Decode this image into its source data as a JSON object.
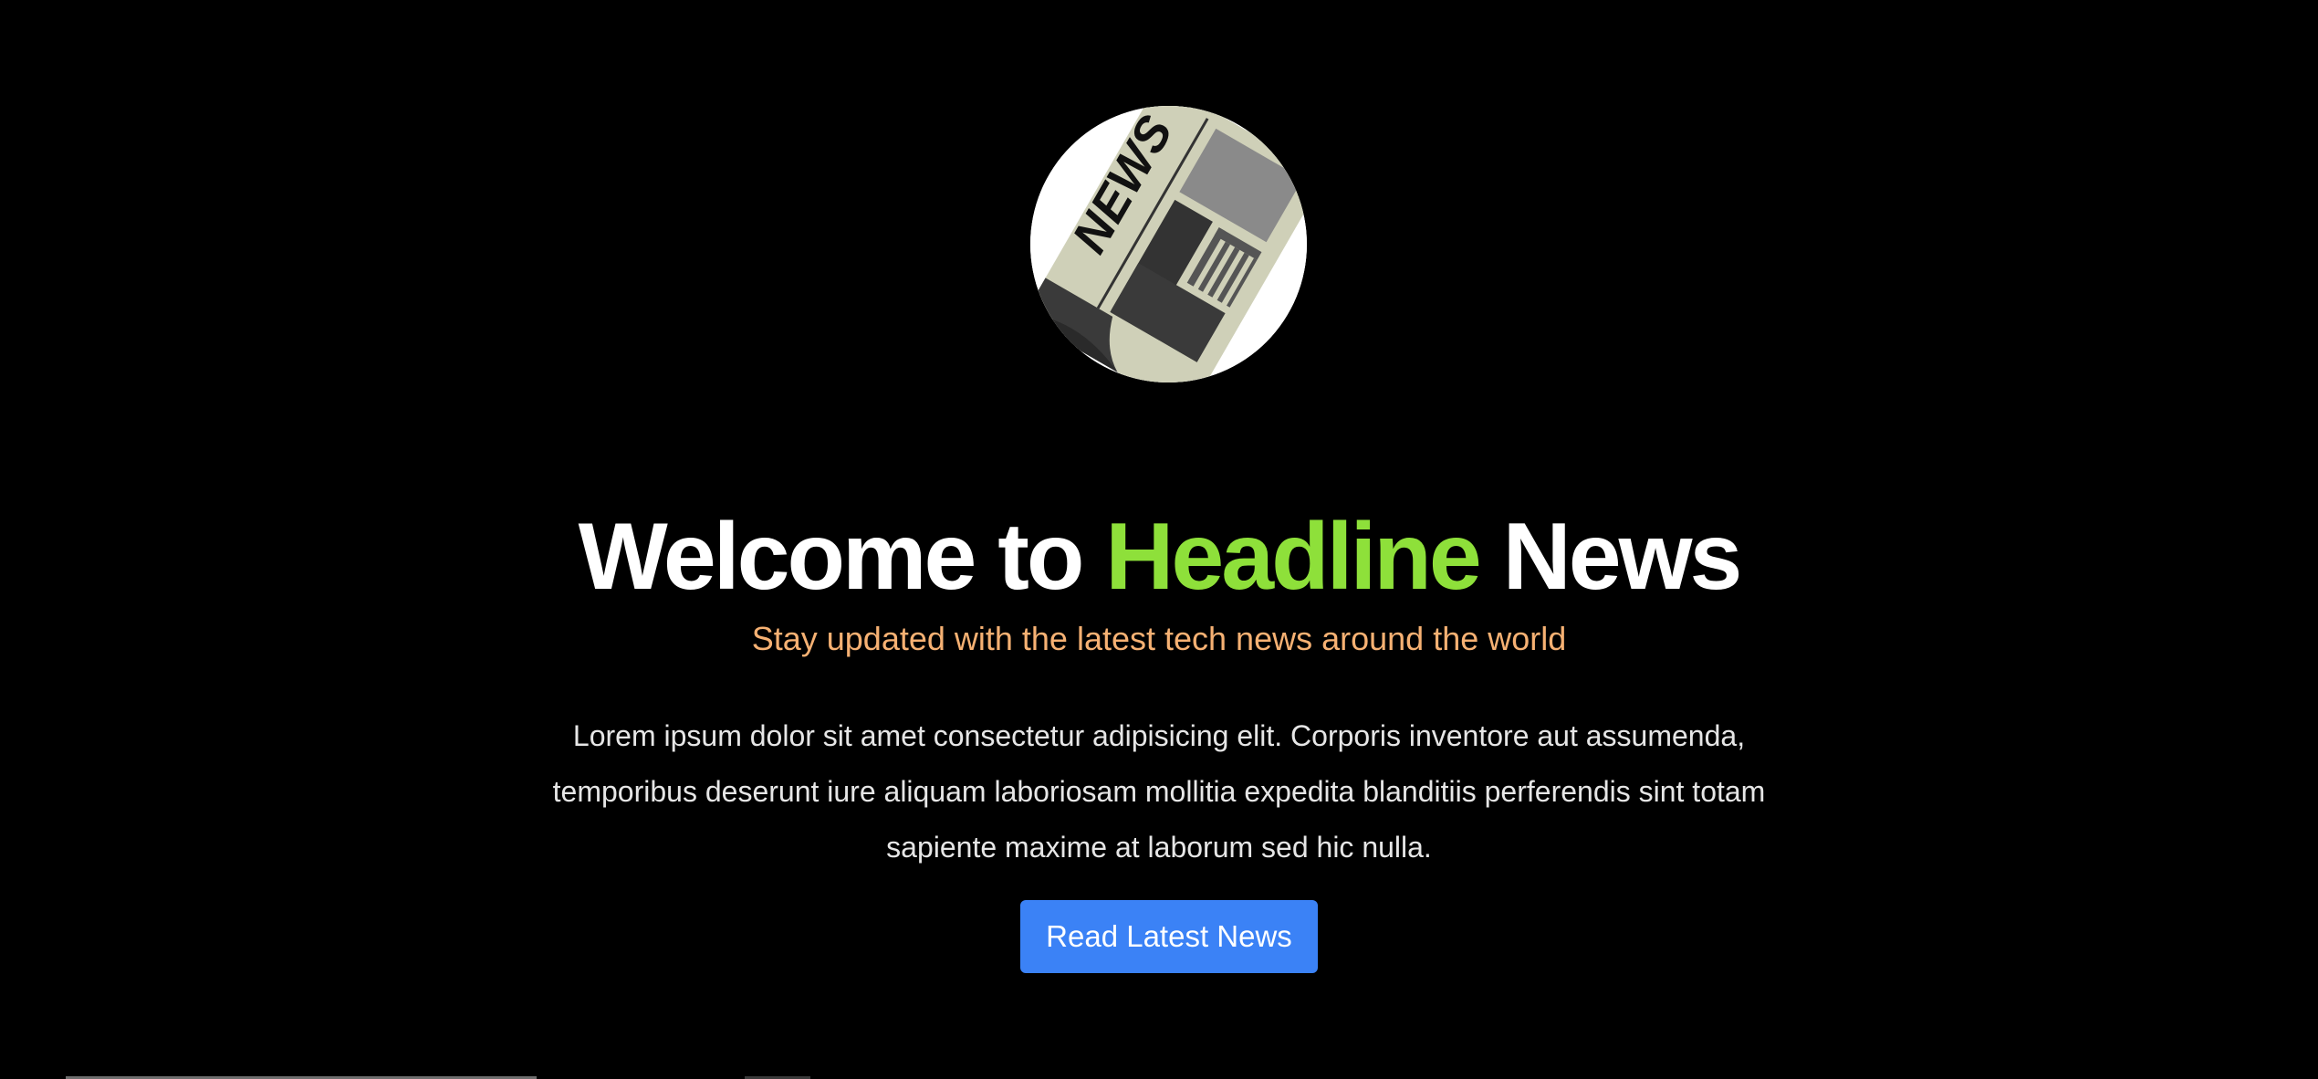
{
  "theme": {
    "background": "#000000",
    "accent_green": "#8ee03a",
    "accent_orange": "#f6b173",
    "accent_blue": "#3b82f6"
  },
  "logo": {
    "icon": "newspaper-icon",
    "word": "NEWS"
  },
  "hero": {
    "title_prefix": "Welcome to ",
    "title_highlight": "Headline",
    "title_suffix": " News",
    "subtitle": "Stay updated with the latest tech news around the world",
    "body": "Lorem ipsum dolor sit amet consectetur adipisicing elit. Corporis inventore aut assumenda, temporibus deserunt iure aliquam laboriosam mollitia expedita blanditiis perferendis sint totam sapiente maxime at laborum sed hic nulla.",
    "cta_label": "Read Latest News"
  }
}
